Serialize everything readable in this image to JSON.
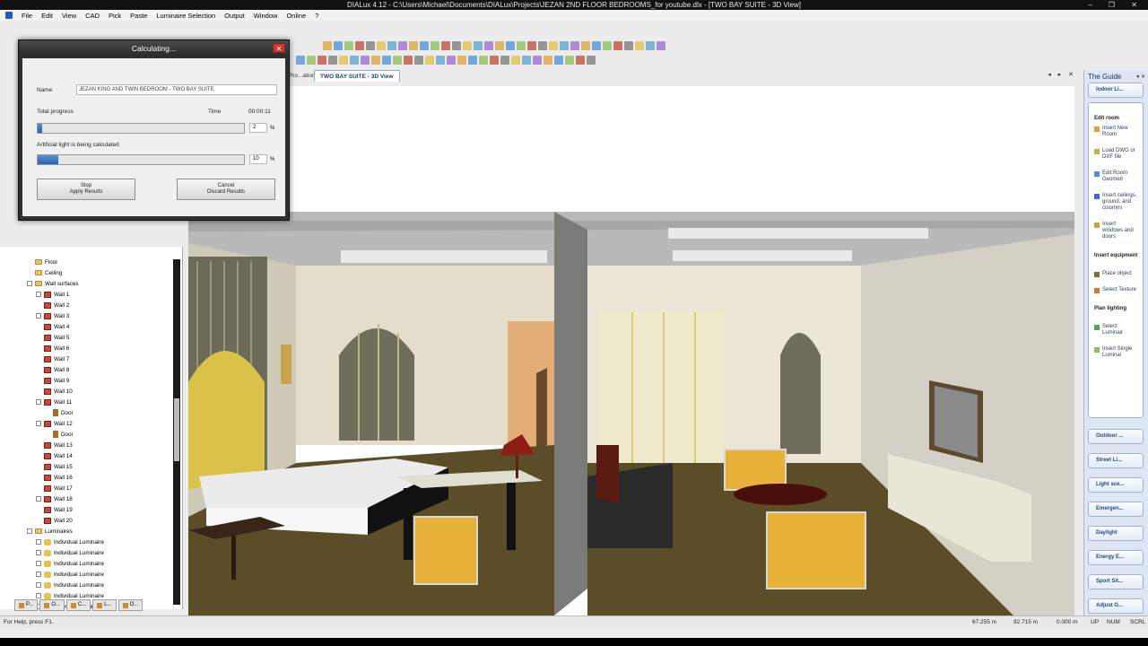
{
  "window": {
    "title": "DIALux 4.12 - C:\\Users\\Michael\\Documents\\DIALux\\Projects\\JEZAN 2ND FLOOR BEDROOMS_for youtube.dlx - [TWO BAY SUITE - 3D View]",
    "controls": "– ❐ ✕"
  },
  "menu": [
    "File",
    "Edit",
    "View",
    "CAD",
    "Pick",
    "Paste",
    "Luminaire Selection",
    "Output",
    "Window",
    "Online",
    "?"
  ],
  "document_tabs": {
    "prev": "Pro...ation",
    "active": "TWO BAY SUITE - 3D View",
    "controls": "◂ ▸ ✕"
  },
  "dialog": {
    "title": "Calculating...",
    "close": "✕",
    "name_label": "Name",
    "name_value": "JEZAN KING AND TWIN BEDROOM - TWO BAY SUITE",
    "total_progress_label": "Total progress",
    "time_label": "Time",
    "time_value": "00:00:11",
    "total_progress_pct": "2",
    "total_progress_fraction": 0.02,
    "subtask_label": "Artificial light is being calculated",
    "subtask_pct": "10",
    "subtask_fraction": 0.1,
    "percent_symbol": "%",
    "stop_line1": "Stop",
    "stop_line2": "Apply Results",
    "cancel_line1": "Cancel",
    "cancel_line2": "Discard Results"
  },
  "tree": {
    "items": [
      {
        "label": "Floor",
        "type": "folder",
        "indent": 1
      },
      {
        "label": "Ceiling",
        "type": "folder",
        "indent": 1
      },
      {
        "label": "Wall surfaces",
        "type": "folder",
        "indent": 1,
        "exp": true
      },
      {
        "label": "Wall 1",
        "type": "wall",
        "indent": 2,
        "exp": true
      },
      {
        "label": "Wall 2",
        "type": "wall",
        "indent": 2
      },
      {
        "label": "Wall 3",
        "type": "wall",
        "indent": 2,
        "exp": true
      },
      {
        "label": "Wall 4",
        "type": "wall",
        "indent": 2
      },
      {
        "label": "Wall 5",
        "type": "wall",
        "indent": 2
      },
      {
        "label": "Wall 6",
        "type": "wall",
        "indent": 2
      },
      {
        "label": "Wall 7",
        "type": "wall",
        "indent": 2
      },
      {
        "label": "Wall 8",
        "type": "wall",
        "indent": 2
      },
      {
        "label": "Wall 9",
        "type": "wall",
        "indent": 2
      },
      {
        "label": "Wall 10",
        "type": "wall",
        "indent": 2
      },
      {
        "label": "Wall 11",
        "type": "wall",
        "indent": 2,
        "exp": true
      },
      {
        "label": "Door",
        "type": "door",
        "indent": 3
      },
      {
        "label": "Wall 12",
        "type": "wall",
        "indent": 2,
        "exp": true
      },
      {
        "label": "Door",
        "type": "door",
        "indent": 3
      },
      {
        "label": "Wall 13",
        "type": "wall",
        "indent": 2
      },
      {
        "label": "Wall 14",
        "type": "wall",
        "indent": 2
      },
      {
        "label": "Wall 15",
        "type": "wall",
        "indent": 2
      },
      {
        "label": "Wall 16",
        "type": "wall",
        "indent": 2
      },
      {
        "label": "Wall 17",
        "type": "wall",
        "indent": 2
      },
      {
        "label": "Wall 18",
        "type": "wall",
        "indent": 2,
        "exp": true
      },
      {
        "label": "Wall 19",
        "type": "wall",
        "indent": 2
      },
      {
        "label": "Wall 20",
        "type": "wall",
        "indent": 2
      },
      {
        "label": "Luminaires",
        "type": "folder",
        "indent": 1,
        "exp": true
      },
      {
        "label": "Individual Luminaire",
        "type": "lum",
        "indent": 2,
        "exp": true
      },
      {
        "label": "Individual Luminaire",
        "type": "lum",
        "indent": 2,
        "exp": true
      },
      {
        "label": "Individual Luminaire",
        "type": "lum",
        "indent": 2,
        "exp": true
      },
      {
        "label": "Individual Luminaire",
        "type": "lum",
        "indent": 2,
        "exp": true
      },
      {
        "label": "Individual Luminaire",
        "type": "lum",
        "indent": 2,
        "exp": true
      },
      {
        "label": "Individual Luminaire",
        "type": "lum",
        "indent": 2,
        "exp": true
      },
      {
        "label": "Individual Luminaire",
        "type": "lum",
        "indent": 2,
        "exp": true
      }
    ]
  },
  "left_tabs": [
    "P...",
    "O...",
    "C...",
    "L...",
    "O..."
  ],
  "guide": {
    "title": "The Guide",
    "controls": "▾ ✕",
    "open_section": "Indoor Li...",
    "groups": [
      {
        "heading": "Edit room",
        "items": [
          "Insert New Room",
          "Load DWG or DXF file",
          "Edit Room Geometr",
          "Insert ceilings, ground, and columns",
          "Insert windows and doors"
        ]
      },
      {
        "heading": "Insert equipment",
        "items": [
          "Place object",
          "Select Texture"
        ]
      },
      {
        "heading": "Plan lighting",
        "items": [
          "Select Luminair",
          "Insert Single Luminai"
        ]
      }
    ],
    "sections": [
      "Outdoor ...",
      "Street Li...",
      "Light sce...",
      "Emergen...",
      "Daylight",
      "Energy E...",
      "Sport Sit...",
      "Adjust G..."
    ]
  },
  "status": {
    "help": "For Help, press F1.",
    "x": "67.255 m",
    "y": "92.715 m",
    "z": "0.000 m",
    "up": "UP",
    "num": "NUM",
    "scrl": "SCRL"
  },
  "colors": {
    "accent": "#2a62b0",
    "wall_icon": "#c84a3a",
    "floor": "#5b4d2a",
    "chair": "#e8b13a"
  }
}
